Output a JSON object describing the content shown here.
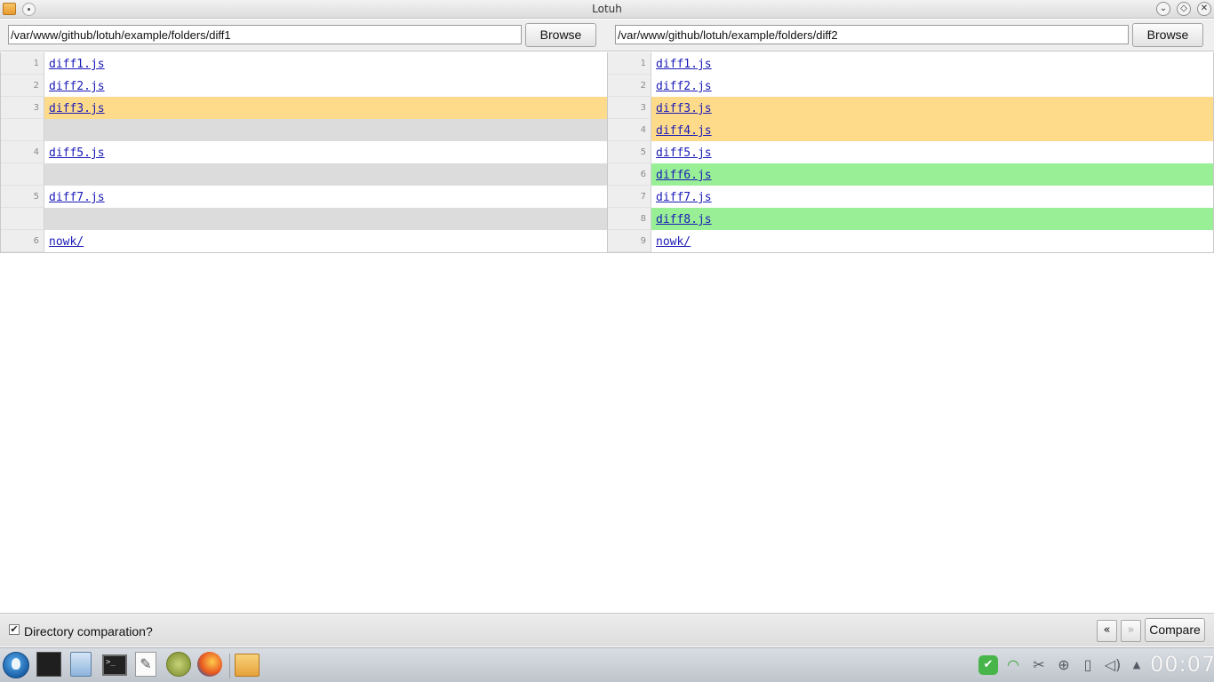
{
  "window": {
    "title": "Lotuh",
    "minimize_glyph": "⌄",
    "maximize_glyph": "◇",
    "close_glyph": "✕"
  },
  "left": {
    "path": "/var/www/github/lotuh/example/folders/diff1",
    "browse_label": "Browse",
    "rows": [
      {
        "num": "1",
        "name": "diff1.js",
        "state": "same"
      },
      {
        "num": "2",
        "name": "diff2.js",
        "state": "same"
      },
      {
        "num": "3",
        "name": "diff3.js",
        "state": "changed"
      },
      {
        "num": "",
        "name": "",
        "state": "empty"
      },
      {
        "num": "4",
        "name": "diff5.js",
        "state": "same"
      },
      {
        "num": "",
        "name": "",
        "state": "empty"
      },
      {
        "num": "5",
        "name": "diff7.js",
        "state": "same"
      },
      {
        "num": "",
        "name": "",
        "state": "empty"
      },
      {
        "num": "6",
        "name": "nowk/",
        "state": "same"
      }
    ]
  },
  "right": {
    "path": "/var/www/github/lotuh/example/folders/diff2",
    "browse_label": "Browse",
    "rows": [
      {
        "num": "1",
        "name": "diff1.js",
        "state": "same"
      },
      {
        "num": "2",
        "name": "diff2.js",
        "state": "same"
      },
      {
        "num": "3",
        "name": "diff3.js",
        "state": "changed"
      },
      {
        "num": "4",
        "name": "diff4.js",
        "state": "changed"
      },
      {
        "num": "5",
        "name": "diff5.js",
        "state": "same"
      },
      {
        "num": "6",
        "name": "diff6.js",
        "state": "added"
      },
      {
        "num": "7",
        "name": "diff7.js",
        "state": "same"
      },
      {
        "num": "8",
        "name": "diff8.js",
        "state": "added"
      },
      {
        "num": "9",
        "name": "nowk/",
        "state": "same"
      }
    ]
  },
  "bottom": {
    "directory_label": "Directory comparation?",
    "directory_checked": true,
    "check_glyph": "✔",
    "prev_label": "«",
    "next_label": "»",
    "compare_label": "Compare"
  },
  "taskbar": {
    "terminal_glyph": ">_",
    "editor_glyph": "✎",
    "tray_shield_glyph": "✔",
    "tray_wifi_glyph": "◠",
    "tray_cut_glyph": "✂",
    "tray_net_glyph": "⊕",
    "tray_battery_glyph": "▯",
    "tray_volume_glyph": "◁)",
    "tray_arrow_glyph": "▲",
    "clock": "00:07"
  },
  "colors": {
    "changed": "#fddb8a",
    "added": "#99ef95",
    "empty": "#dcdcdc",
    "link": "#1a1ab8"
  }
}
